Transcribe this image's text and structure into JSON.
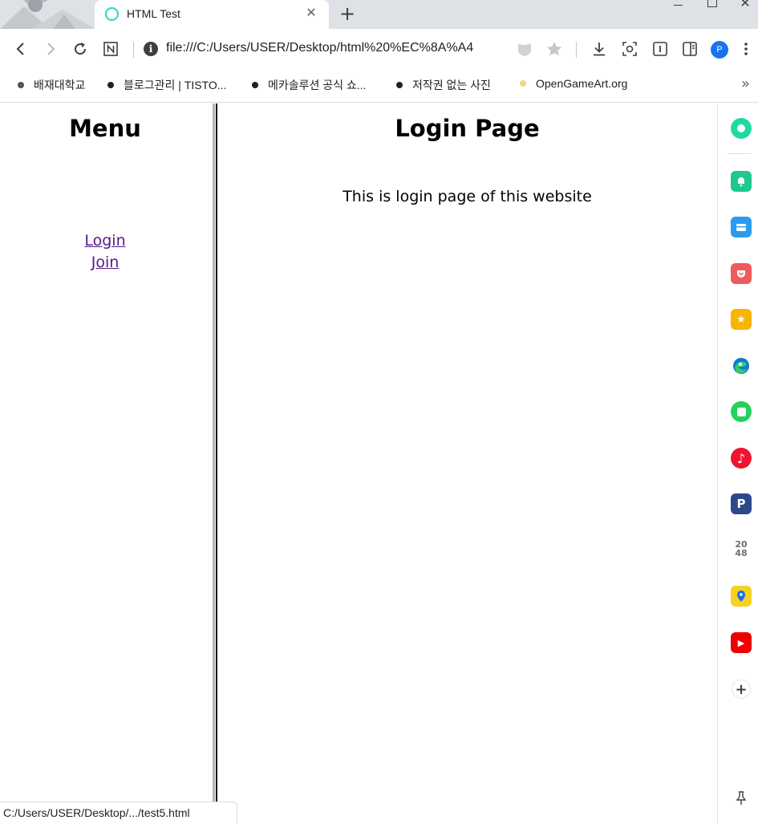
{
  "browser": {
    "tab": {
      "title": "HTML Test"
    },
    "address_bar": {
      "url": "file:///C:/Users/USER/Desktop/html%20%EC%8A%A4"
    },
    "profile_initial": "P",
    "bookmarks": [
      {
        "label": "배재대학교",
        "dot_color": "#555555"
      },
      {
        "label": "블로그관리 | TISTO...",
        "dot_color": "#202124"
      },
      {
        "label": "메카솔루션 공식 쇼...",
        "dot_color": "#202124"
      },
      {
        "label": "저작권 없는 사진",
        "dot_color": "#202124"
      },
      {
        "label": "OpenGameArt.org",
        "dot_color": "#e8d88a"
      }
    ],
    "status_bar": "C:/Users/USER/Desktop/.../test5.html"
  },
  "page": {
    "menu": {
      "heading": "Menu",
      "links": [
        "Login",
        "Join"
      ]
    },
    "content": {
      "heading": "Login Page",
      "description": "This is login page of this website"
    }
  },
  "side_panel": {
    "icons": [
      {
        "name": "green-circle-app-icon",
        "color": "#1ed9a0",
        "glyph": ""
      },
      {
        "name": "notification-bell-icon",
        "color": "#1ec88f",
        "glyph": ""
      },
      {
        "name": "wallet-icon",
        "color": "#2b9bf0",
        "glyph": ""
      },
      {
        "name": "pocket-icon",
        "color": "#ef5a5a",
        "glyph": ""
      },
      {
        "name": "star-favorites-icon",
        "color": "#f7b500",
        "glyph": "★"
      },
      {
        "name": "edge-browser-icon",
        "color": "#0c7bd6",
        "glyph": ""
      },
      {
        "name": "green-square-app-icon",
        "color": "#21d35c",
        "glyph": ""
      },
      {
        "name": "music-note-icon",
        "color": "#f0142f",
        "glyph": "♪"
      },
      {
        "name": "papago-p-icon",
        "color": "#2c4a8a",
        "glyph": "P"
      },
      {
        "name": "game-2048-icon",
        "color": "#ffffff",
        "glyph": "2048"
      },
      {
        "name": "map-pin-icon",
        "color": "#f6d21e",
        "glyph": ""
      },
      {
        "name": "youtube-icon",
        "color": "#f00000",
        "glyph": "▶"
      }
    ]
  }
}
